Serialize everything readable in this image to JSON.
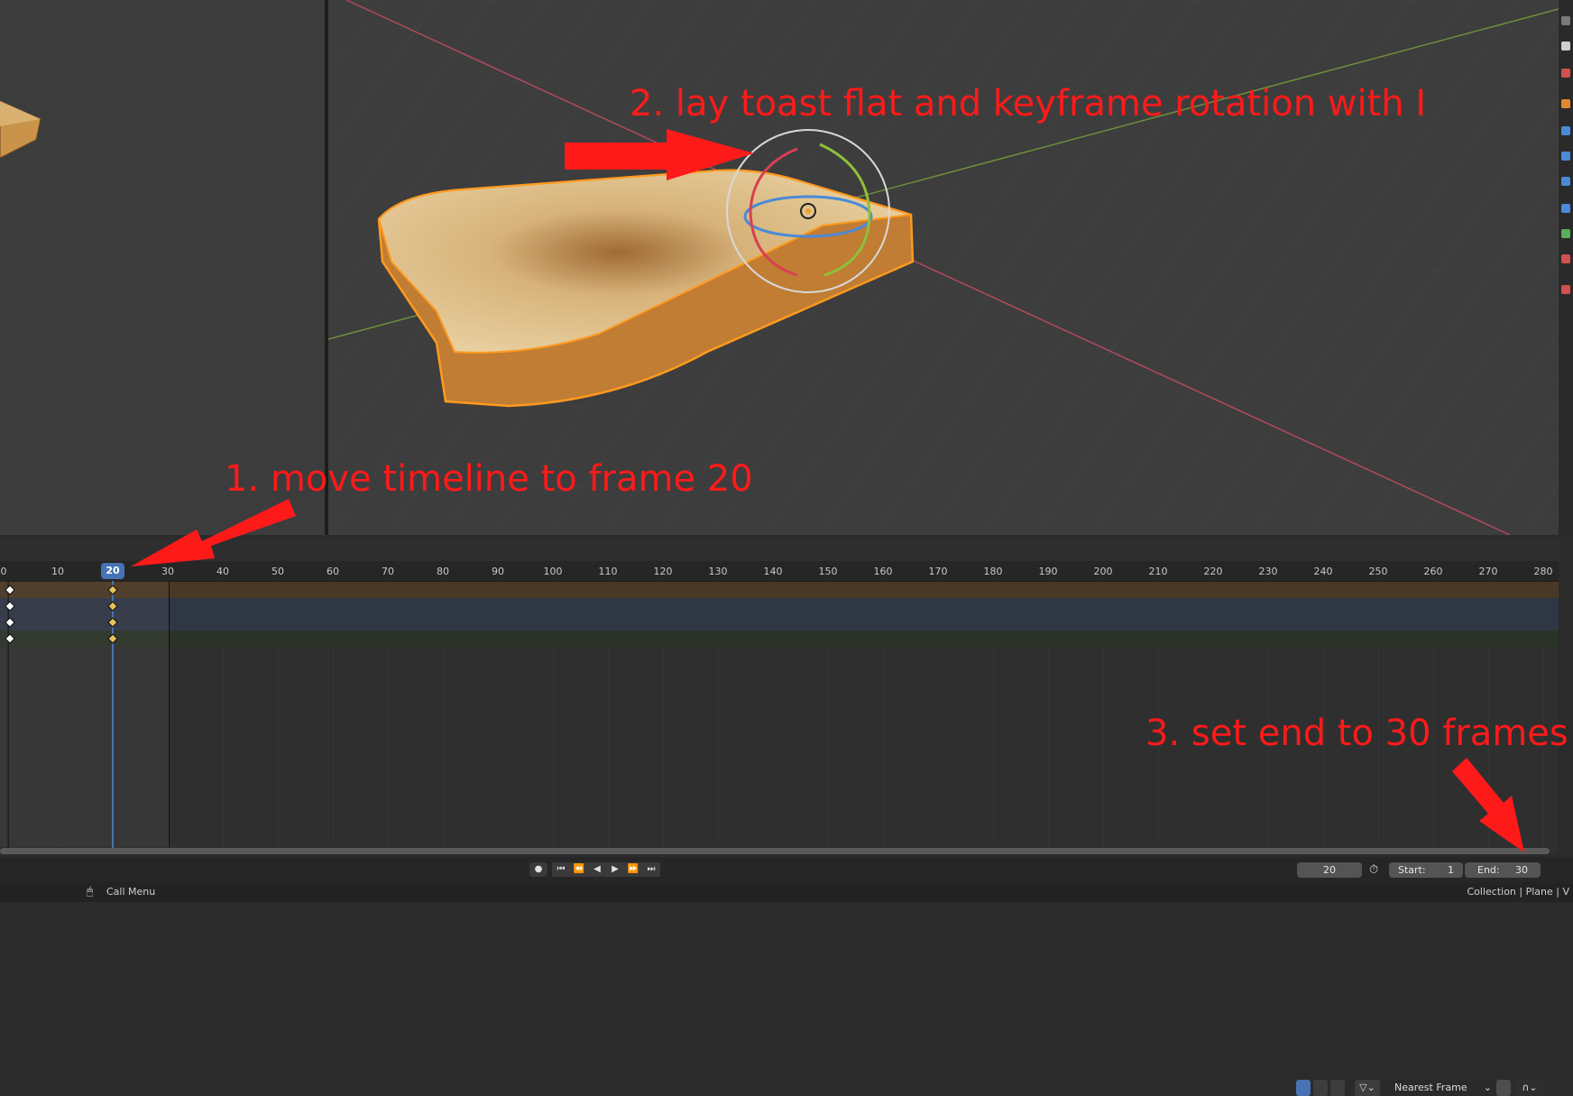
{
  "annotations": {
    "step1": "1. move timeline to frame 20",
    "step2": "2. lay toast flat and keyframe rotation with I",
    "step3": "3. set end to 30 frames"
  },
  "timeline": {
    "header": {
      "snapping_mode": "Nearest Frame"
    },
    "ruler_ticks": [
      "0",
      "10",
      "20",
      "30",
      "40",
      "50",
      "60",
      "70",
      "80",
      "90",
      "100",
      "110",
      "120",
      "130",
      "140",
      "150",
      "160",
      "170",
      "180",
      "190",
      "200",
      "210",
      "220",
      "230",
      "240",
      "250",
      "260",
      "270",
      "280"
    ],
    "current_frame_badge": "20",
    "keyframe_frames": [
      0,
      20
    ],
    "channel_count": 4
  },
  "playback": {
    "current_frame": "20",
    "start_label": "Start:",
    "start_value": "1",
    "end_label": "End:",
    "end_value": "30"
  },
  "status_bar": {
    "call_menu": "Call Menu",
    "context": "Collection | Plane | V"
  },
  "colors": {
    "annotation": "#ff1a1a",
    "selection_blue": "#4772b3",
    "keyframe_yellow": "#e8c35a",
    "toast_outline": "#ff9a1f"
  },
  "icons": {
    "record": "record-icon",
    "jump_start": "jump-start-icon",
    "prev_key": "prev-keyframe-icon",
    "play_reverse": "play-reverse-icon",
    "play": "play-icon",
    "next_key": "next-keyframe-icon",
    "jump_end": "jump-end-icon",
    "clock": "clock-icon",
    "mouse": "mouse-icon"
  }
}
